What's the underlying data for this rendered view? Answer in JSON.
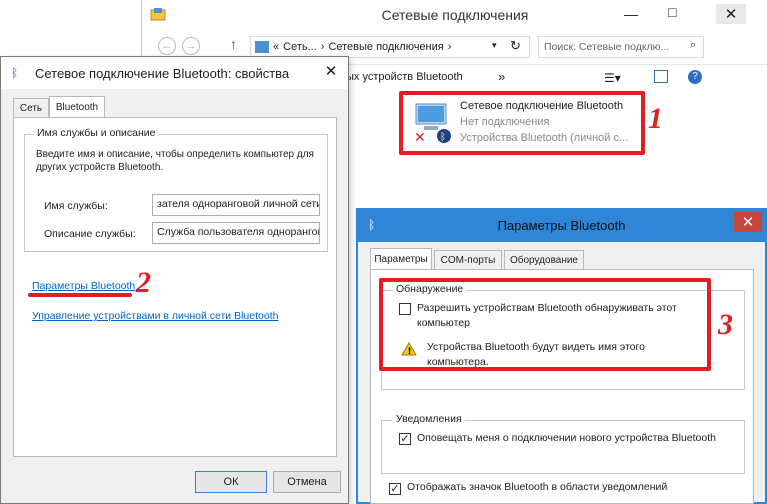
{
  "back_window": {
    "title": "Сетевые подключения",
    "breadcrumb_1": "Сеть...",
    "breadcrumb_2": "Сетевые подключения",
    "search_placeholder": "Поиск: Сетевые подклю...",
    "toolbar_text": "ых устройств Bluetooth",
    "toolbar_more": "»",
    "connection": {
      "name": "Сетевое подключение Bluetooth",
      "status": "Нет подключения",
      "device": "Устройства Bluetooth (личной с..."
    }
  },
  "props_dialog": {
    "title": "Сетевое подключение Bluetooth: свойства",
    "tabs": [
      "Сеть",
      "Bluetooth"
    ],
    "group_title": "Имя службы и описание",
    "group_desc": "Введите имя и описание, чтобы определить компьютер для других устройств Bluetooth.",
    "service_name_label": "Имя службы:",
    "service_name_value": "зателя одноранговой личной сети",
    "service_desc_label": "Описание службы:",
    "service_desc_value": "Служба пользователя одноранговс",
    "link_params": "Параметры Bluetooth",
    "link_manage": "Управление устройствами в личной сети Bluetooth",
    "ok_label": "ОК",
    "cancel_label": "Отмена"
  },
  "bt_dialog": {
    "title": "Параметры Bluetooth",
    "tabs": [
      "Параметры",
      "COM-порты",
      "Оборудование"
    ],
    "discovery_title": "Обнаружение",
    "discovery_checkbox": "Разрешить устройствам Bluetooth обнаруживать этот компьютер",
    "discovery_checked": false,
    "warning_text": "Устройства Bluetooth будут видеть имя этого компьютера.",
    "notify_title": "Уведомления",
    "notify_checkbox": "Оповещать меня о подключении нового устройства Bluetooth",
    "notify_checked": true,
    "tray_checkbox": "Отображать значок Bluetooth в области уведомлений",
    "tray_checked": true
  },
  "annotations": {
    "n1": "1",
    "n2": "2",
    "n3": "3"
  },
  "colors": {
    "accent_blue": "#2f86d6",
    "annotation_red": "#e01e24",
    "link": "#0066cc"
  }
}
